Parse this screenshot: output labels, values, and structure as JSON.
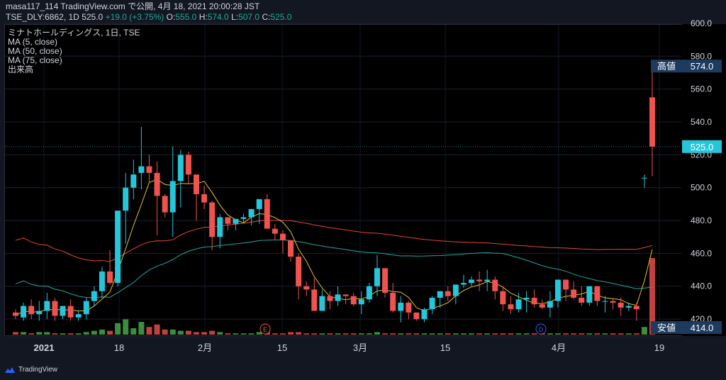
{
  "header": {
    "line1": "masa117_114 TradingView.com で公開, 4月 18, 2021 20:00:28 JST",
    "symbol": "TSE_DLY:6862, 1D",
    "last_price": "525.0",
    "change": "+19.0 (+3.75%)",
    "o_label": "O:",
    "o_value": "555.0",
    "h_label": "H:",
    "h_value": "574.0",
    "l_label": "L:",
    "l_value": "507.0",
    "c_label": "C:",
    "c_value": "525.0"
  },
  "legend": {
    "title": "ミナトホールディングス, 1日, TSE",
    "ma5": "MA (5, close)",
    "ma50": "MA (50, close)",
    "ma75": "MA (75, close)",
    "volume": "出来高"
  },
  "markers": {
    "high_label": "高値",
    "high_value": "574.0",
    "low_label": "安値",
    "low_value": "414.0",
    "last_value": "525.0",
    "earnings": "E",
    "dividend": "D"
  },
  "footer": {
    "brand": "TradingView"
  },
  "colors": {
    "up": "#26c6da",
    "down": "#ef5350",
    "ma5": "#e6c229",
    "ma50": "#26a69a",
    "ma75": "#e0463a",
    "volume_up": "#4caf50",
    "volume_down": "#ef5350",
    "marker_bg": "#1e3a5f"
  },
  "chart_data": {
    "type": "candlestick",
    "ylim": [
      414,
      603
    ],
    "yticks": [
      420.0,
      440.0,
      460.0,
      480.0,
      500.0,
      520.0,
      540.0,
      560.0,
      580.0,
      600.0
    ],
    "xticks": [
      "2021",
      "18",
      "2月",
      "15",
      "3月",
      "15",
      "4月",
      "19"
    ],
    "series": [
      {
        "name": "candles",
        "values": [
          [
            424,
            426,
            420,
            422
          ],
          [
            421,
            430,
            419,
            428
          ],
          [
            428,
            432,
            420,
            423
          ],
          [
            423,
            431,
            419,
            425
          ],
          [
            425,
            436,
            420,
            431
          ],
          [
            431,
            433,
            419,
            422
          ],
          [
            422,
            428,
            420,
            428
          ],
          [
            428,
            432,
            419,
            421
          ],
          [
            421,
            425,
            419,
            423
          ],
          [
            423,
            433,
            420,
            431
          ],
          [
            431,
            440,
            428,
            437
          ],
          [
            437,
            452,
            433,
            449
          ],
          [
            449,
            462,
            441,
            442
          ],
          [
            442,
            484,
            440,
            486
          ],
          [
            486,
            509,
            466,
            500
          ],
          [
            500,
            517,
            493,
            508
          ],
          [
            509,
            537,
            499,
            513
          ],
          [
            513,
            520,
            503,
            509
          ],
          [
            509,
            516,
            471,
            495
          ],
          [
            495,
            496,
            482,
            485
          ],
          [
            485,
            525,
            470,
            504
          ],
          [
            504,
            523,
            488,
            520
          ],
          [
            520,
            522,
            502,
            508
          ],
          [
            508,
            504,
            480,
            496
          ],
          [
            496,
            501,
            487,
            491
          ],
          [
            491,
            492,
            462,
            470
          ],
          [
            470,
            484,
            463,
            482
          ],
          [
            482,
            482,
            474,
            478
          ],
          [
            478,
            481,
            474,
            481
          ],
          [
            481,
            484,
            479,
            482
          ],
          [
            482,
            487,
            477,
            487
          ],
          [
            487,
            493,
            478,
            493
          ],
          [
            493,
            496,
            475,
            475
          ],
          [
            475,
            478,
            468,
            472
          ],
          [
            472,
            474,
            460,
            468
          ],
          [
            468,
            459,
            455,
            458
          ],
          [
            458,
            460,
            432,
            440
          ],
          [
            440,
            443,
            434,
            438
          ],
          [
            438,
            445,
            428,
            425
          ],
          [
            425,
            438,
            425,
            434
          ],
          [
            434,
            437,
            426,
            431
          ],
          [
            431,
            440,
            428,
            435
          ],
          [
            435,
            434,
            429,
            434
          ],
          [
            434,
            436,
            428,
            429
          ],
          [
            429,
            437,
            423,
            432
          ],
          [
            432,
            442,
            430,
            440
          ],
          [
            440,
            459,
            434,
            451
          ],
          [
            451,
            443,
            433,
            436
          ],
          [
            436,
            442,
            424,
            425
          ],
          [
            425,
            434,
            418,
            430
          ],
          [
            430,
            431,
            420,
            424
          ],
          [
            424,
            424,
            419,
            420
          ],
          [
            420,
            427,
            418,
            426
          ],
          [
            426,
            434,
            423,
            433
          ],
          [
            433,
            437,
            427,
            437
          ],
          [
            437,
            440,
            431,
            434
          ],
          [
            434,
            440,
            429,
            441
          ],
          [
            441,
            447,
            439,
            442
          ],
          [
            442,
            446,
            440,
            444
          ],
          [
            444,
            449,
            437,
            443
          ],
          [
            443,
            450,
            437,
            444
          ],
          [
            444,
            446,
            432,
            437
          ],
          [
            437,
            440,
            425,
            429
          ],
          [
            429,
            434,
            423,
            426
          ],
          [
            426,
            436,
            424,
            432
          ],
          [
            432,
            437,
            424,
            433
          ],
          [
            433,
            438,
            427,
            429
          ],
          [
            429,
            432,
            426,
            427
          ],
          [
            427,
            437,
            421,
            431
          ],
          [
            431,
            441,
            427,
            444
          ],
          [
            444,
            444,
            431,
            438
          ],
          [
            438,
            443,
            432,
            433
          ],
          [
            433,
            440,
            428,
            430
          ],
          [
            430,
            438,
            428,
            440
          ],
          [
            440,
            438,
            428,
            431
          ],
          [
            431,
            434,
            424,
            431
          ],
          [
            431,
            432,
            426,
            430
          ],
          [
            430,
            433,
            422,
            427
          ],
          [
            427,
            430,
            425,
            428
          ],
          [
            428,
            430,
            419,
            426
          ],
          [
            506,
            508,
            500,
            506
          ],
          [
            555,
            574,
            507,
            525
          ]
        ]
      },
      {
        "name": "volume",
        "values": [
          2,
          2,
          1,
          2,
          2,
          1,
          1,
          1,
          1,
          2,
          3,
          4,
          3,
          9,
          12,
          5,
          10,
          6,
          8,
          4,
          4,
          3,
          3,
          2,
          2,
          3,
          2,
          1,
          1,
          1,
          1,
          2,
          2,
          1,
          1,
          2,
          2,
          1,
          1,
          1,
          1,
          1,
          1,
          1,
          1,
          1,
          2,
          1,
          1,
          1,
          1,
          1,
          1,
          1,
          1,
          1,
          1,
          1,
          1,
          1,
          1,
          1,
          1,
          1,
          1,
          1,
          1,
          1,
          1,
          1,
          1,
          1,
          1,
          1,
          1,
          1,
          1,
          1,
          1,
          1,
          6,
          60
        ]
      }
    ]
  }
}
